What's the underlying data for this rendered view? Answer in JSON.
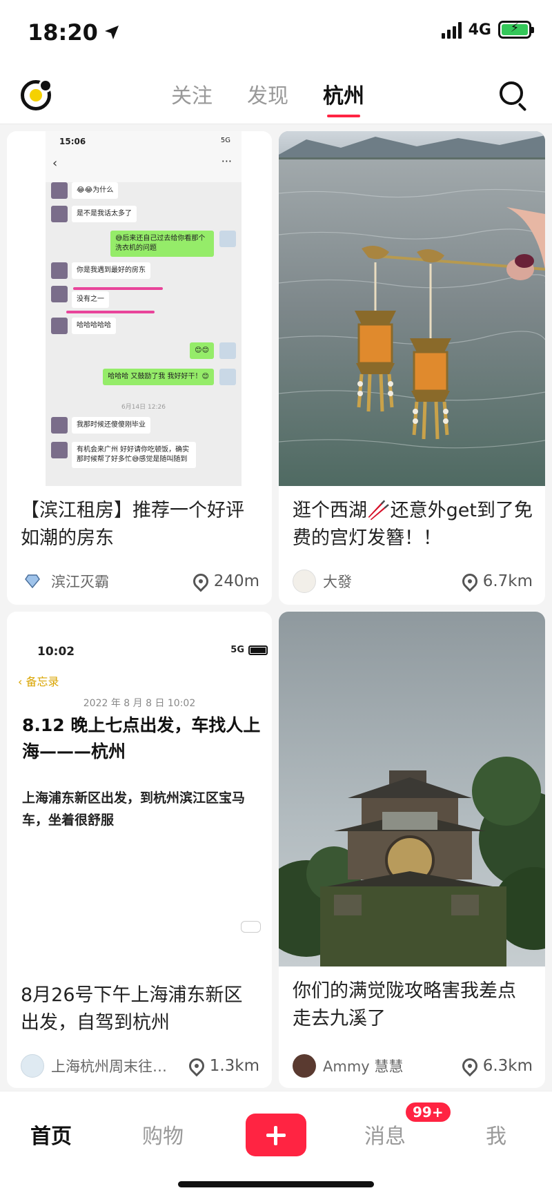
{
  "status_bar": {
    "time": "18:20",
    "network": "4G"
  },
  "header": {
    "tabs": [
      {
        "label": "关注",
        "active": false
      },
      {
        "label": "发现",
        "active": false
      },
      {
        "label": "杭州",
        "active": true
      }
    ],
    "logo_icon": "app-logo-icon",
    "search_icon": "search-icon",
    "active_tab_color": "#ff2442"
  },
  "feed": {
    "cards": [
      {
        "title": "【滨江租房】推荐一个好评如潮的房东",
        "author": "滨江灭霸",
        "distance": "240m",
        "image": {
          "type": "chat-screenshot",
          "time": "15:06",
          "network": "5G",
          "messages": [
            {
              "side": "left",
              "text": "😂😂为什么"
            },
            {
              "side": "left",
              "text": "是不是我话太多了"
            },
            {
              "side": "right",
              "text": "😅后来还自己过去给你看那个洗衣机的问题"
            },
            {
              "side": "left",
              "text": "你是我遇到最好的房东"
            },
            {
              "side": "left",
              "text": "没有之一"
            },
            {
              "side": "left",
              "text": "哈哈哈哈哈"
            },
            {
              "side": "right",
              "text": "😊😊"
            },
            {
              "side": "right",
              "text": "哈哈哈 又鼓励了我 我好好干！😊"
            },
            {
              "side": "left",
              "text": "我那时候还傻傻刚毕业"
            },
            {
              "side": "left",
              "text": "有机会来广州 好好请你吃顿饭，确实那时候帮了好多忙😅感觉是随叫随到"
            }
          ],
          "date_stamp": "6月14日 12:26"
        }
      },
      {
        "title": "逛个西湖🥢还意外get到了免费的宫灯发簪！！",
        "author": "大發",
        "distance": "6.7km",
        "image": {
          "type": "photo",
          "subject": "lantern-hairpin-over-lake"
        }
      },
      {
        "title": "8月26号下午上海浦东新区出发，自驾到杭州",
        "author": "上海杭州周末往…",
        "distance": "1.3km",
        "image": {
          "type": "memo-screenshot",
          "time": "10:02",
          "network": "5G",
          "back_label": "备忘录",
          "date": "2022 年 8 月 8 日 10:02",
          "heading": "8.12 晚上七点出发，车找人上海———杭州",
          "body": "上海浦东新区出发，到杭州滨江区宝马车，坐着很舒服"
        }
      },
      {
        "title": "你们的满觉陇攻略害我差点走去九溪了",
        "author": "Ammy 慧慧",
        "distance": "6.3km",
        "image": {
          "type": "photo",
          "subject": "wooden-pagoda-building"
        }
      }
    ]
  },
  "bottom_nav": {
    "items": [
      {
        "label": "首页",
        "active": true
      },
      {
        "label": "购物",
        "active": false
      },
      {
        "label": "消息",
        "active": false
      },
      {
        "label": "我",
        "active": false
      }
    ],
    "messages_badge": "99+",
    "publish_icon": "plus-icon",
    "accent": "#ff2442"
  }
}
